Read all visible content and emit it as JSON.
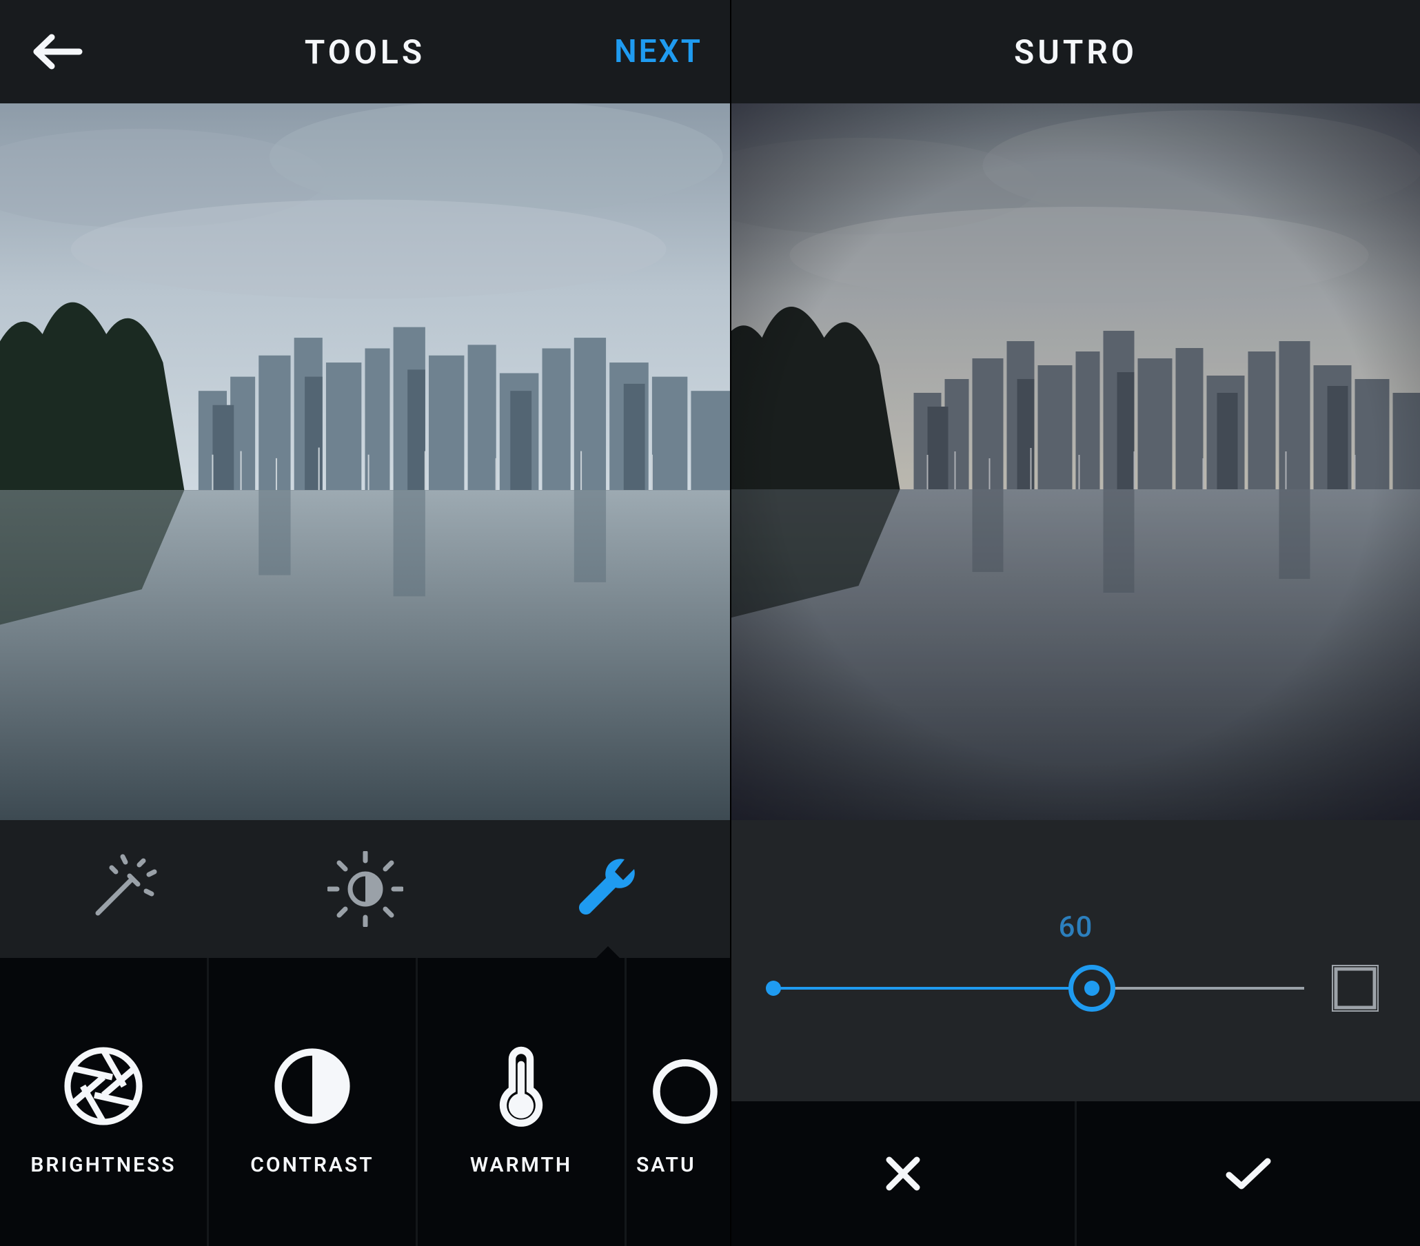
{
  "left": {
    "header": {
      "title": "TOOLS",
      "next_label": "NEXT"
    },
    "mode_tabs": [
      {
        "id": "lux",
        "icon": "magic-wand-icon",
        "active": false
      },
      {
        "id": "contrast",
        "icon": "exposure-icon",
        "active": false
      },
      {
        "id": "edit",
        "icon": "wrench-icon",
        "active": true
      }
    ],
    "tools": [
      {
        "id": "brightness",
        "label": "BRIGHTNESS",
        "icon": "aperture-icon"
      },
      {
        "id": "contrast",
        "label": "CONTRAST",
        "icon": "contrast-icon"
      },
      {
        "id": "warmth",
        "label": "WARMTH",
        "icon": "thermometer-icon"
      },
      {
        "id": "saturation",
        "label": "SATURATION",
        "icon": "droplet-icon"
      }
    ]
  },
  "right": {
    "header": {
      "title": "SUTRO"
    },
    "slider": {
      "value": 60,
      "min": 0,
      "max": 100,
      "frame_icon": "frame-icon"
    },
    "actions": {
      "cancel_icon": "close-icon",
      "confirm_icon": "check-icon"
    }
  },
  "colors": {
    "accent": "#1f9bf0",
    "accent_soft": "#2c7fbd",
    "background": "#0f1214",
    "bar": "#181b1e"
  }
}
